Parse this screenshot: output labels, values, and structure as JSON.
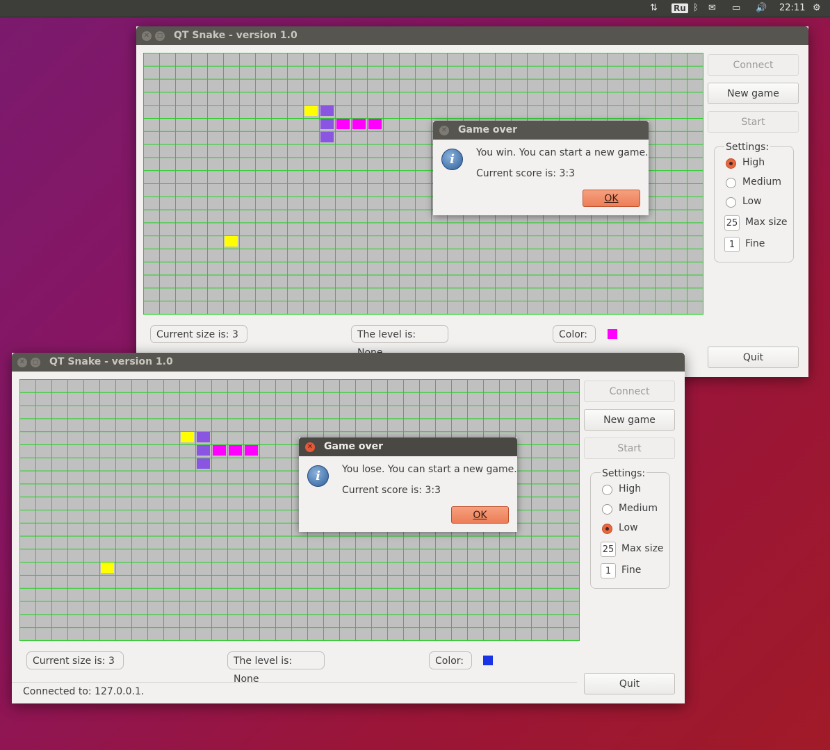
{
  "topbar": {
    "keyboard": "Ru",
    "clock": "22:11"
  },
  "window1": {
    "title": "QT Snake - version 1.0",
    "buttons": {
      "connect": "Connect",
      "new_game": "New game",
      "start": "Start",
      "quit": "Quit"
    },
    "settings": {
      "label": "Settings:",
      "high": "High",
      "medium": "Medium",
      "low": "Low",
      "selected": "High",
      "max_size_value": "25",
      "max_size_label": "Max size",
      "fine_value": "1",
      "fine_label": "Fine"
    },
    "status": {
      "size": "Current size is: 3",
      "level": "The level is: None",
      "color_label": "Color:",
      "color": "#ff00ff"
    },
    "dialog": {
      "title": "Game over",
      "message": "You win. You can start a new game.",
      "score": "Current score is: 3:3",
      "ok": "OK"
    }
  },
  "window2": {
    "title": "QT Snake - version 1.0",
    "buttons": {
      "connect": "Connect",
      "new_game": "New game",
      "start": "Start",
      "quit": "Quit"
    },
    "settings": {
      "label": "Settings:",
      "high": "High",
      "medium": "Medium",
      "low": "Low",
      "selected": "Low",
      "max_size_value": "25",
      "max_size_label": "Max size",
      "fine_value": "1",
      "fine_label": "Fine"
    },
    "status": {
      "size": "Current size is: 3",
      "level": "The level is: None",
      "color_label": "Color:",
      "color": "#1a33e6"
    },
    "statusbar": "Connected to: 127.0.0.1.",
    "dialog": {
      "title": "Game over",
      "message": "You lose. You can start a new game.",
      "score": "Current score is: 3:3",
      "ok": "OK"
    }
  },
  "colors": {
    "food": "#ffff00",
    "snake_head": "#8a55e0",
    "snake_body": "#ff00ff",
    "board": "#c0c0c0",
    "grid": "#22d022"
  }
}
